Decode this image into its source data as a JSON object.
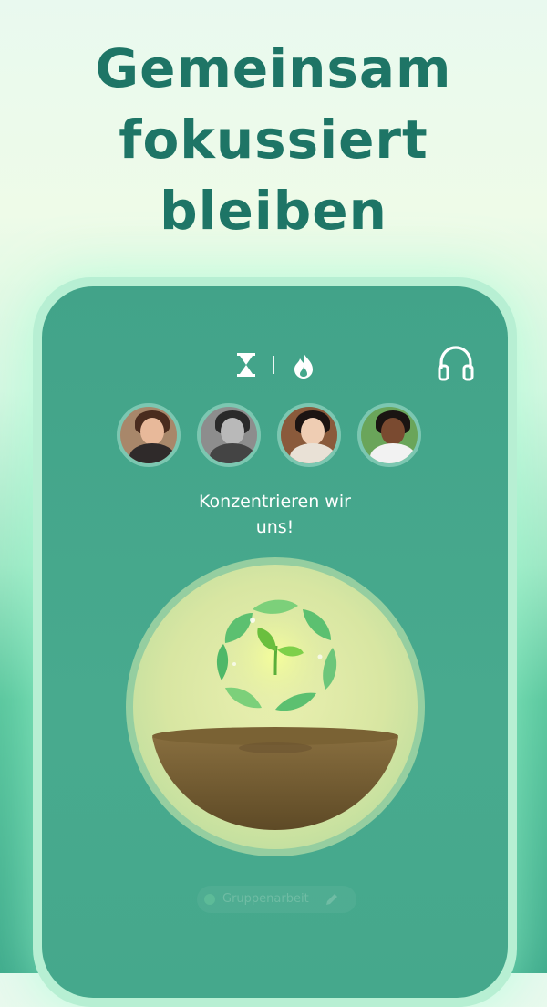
{
  "headline": {
    "line1": "Gemeinsam",
    "line2": "fokussiert",
    "line3": "bleiben"
  },
  "topbar": {
    "left_icon": "hourglass-icon",
    "right_icon": "flame-icon",
    "audio_icon": "headphones-icon"
  },
  "participants": [
    {
      "name": "participant-1"
    },
    {
      "name": "participant-2"
    },
    {
      "name": "participant-3"
    },
    {
      "name": "participant-4"
    }
  ],
  "status": {
    "line1": "Konzentrieren wir",
    "line2": "uns!"
  },
  "tag": {
    "label": "Gruppenarbeit",
    "edit_icon": "pencil-icon"
  },
  "colors": {
    "headline": "#1e7566",
    "screen_bg": "#45a88c",
    "accent": "#7cc7b1"
  }
}
